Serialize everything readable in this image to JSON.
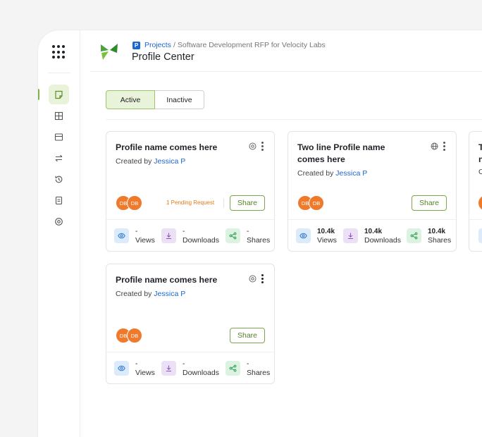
{
  "header": {
    "breadcrumb_project_badge": "P",
    "breadcrumb_projects": "Projects",
    "breadcrumb_separator": "/",
    "breadcrumb_current": "Software Development RFP for Velocity Labs",
    "title": "Profile Center"
  },
  "sidebar": {
    "items": [
      {
        "icon": "note-icon",
        "active": true
      },
      {
        "icon": "table-grid-icon",
        "active": false
      },
      {
        "icon": "window-icon",
        "active": false
      },
      {
        "icon": "transfer-arrows-icon",
        "active": false
      },
      {
        "icon": "history-icon",
        "active": false
      },
      {
        "icon": "document-icon",
        "active": false
      },
      {
        "icon": "circle-at-icon",
        "active": false
      }
    ]
  },
  "tabs": {
    "active_label": "Active",
    "inactive_label": "Inactive"
  },
  "cards": [
    {
      "title": "Profile name comes here",
      "created_prefix": "Created by",
      "author": "Jessica P",
      "visibility_icon": "at-icon",
      "avatars": [
        "DB",
        "DB"
      ],
      "pending": "1 Pending Request",
      "share_label": "Share",
      "stats": {
        "views_value": "-",
        "views_label": "Views",
        "downloads_value": "-",
        "downloads_label": "Downloads",
        "shares_value": "-",
        "shares_label": "Shares"
      }
    },
    {
      "title": "Two line Profile name comes here",
      "created_prefix": "Created by",
      "author": "Jessica P",
      "visibility_icon": "globe-icon",
      "avatars": [
        "DB",
        "DB"
      ],
      "share_label": "Share",
      "stats": {
        "views_value": "10.4k",
        "views_label": "Views",
        "downloads_value": "10.4k",
        "downloads_label": "Downloads",
        "shares_value": "10.4k",
        "shares_label": "Shares"
      }
    },
    {
      "title": "Profile name comes here",
      "created_prefix": "Created by",
      "author": "Jessica P",
      "visibility_icon": "at-icon",
      "avatars": [
        "DB",
        "DB"
      ],
      "share_label": "Share",
      "stats": {
        "views_value": "-",
        "views_label": "Views",
        "downloads_value": "-",
        "downloads_label": "Downloads",
        "shares_value": "-",
        "shares_label": "Shares"
      }
    }
  ],
  "partial_card": {
    "title_start": "T",
    "title_line2_start": "n",
    "created_start": "C"
  },
  "colors": {
    "accent_green": "#7fb348",
    "active_tab_bg": "#e8f3da",
    "link_blue": "#1a66d2",
    "avatar_orange": "#f07a2b",
    "pending_orange": "#e07a18"
  }
}
